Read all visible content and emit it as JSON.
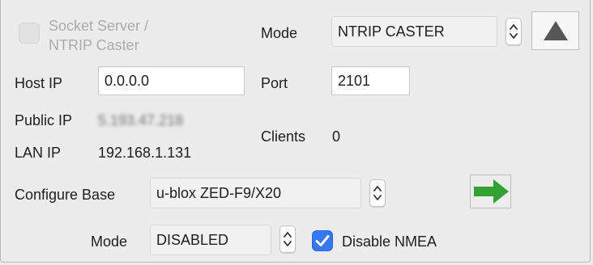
{
  "server": {
    "enable_label": "Socket Server /\nNTRIP Caster",
    "enabled": false,
    "mode_label": "Mode",
    "mode_value": "NTRIP CASTER",
    "host_ip_label": "Host IP",
    "host_ip_value": "0.0.0.0",
    "port_label": "Port",
    "port_value": "2101",
    "public_ip_label": "Public IP",
    "public_ip_value": "5.193.47.218",
    "lan_ip_label": "LAN IP",
    "lan_ip_value": "192.168.1.131",
    "clients_label": "Clients",
    "clients_value": "0",
    "collapse_icon": "triangle-up-icon"
  },
  "base": {
    "configure_label": "Configure Base",
    "receiver_value": "u-blox ZED-F9/X20",
    "send_icon": "right-arrow-icon",
    "mode_label": "Mode",
    "mode_value": "DISABLED",
    "disable_nmea_label": "Disable NMEA",
    "disable_nmea_checked": true
  },
  "colors": {
    "arrow_green": "#33a033",
    "checkbox_blue": "#3478f6",
    "triangle_gray": "#575757"
  }
}
